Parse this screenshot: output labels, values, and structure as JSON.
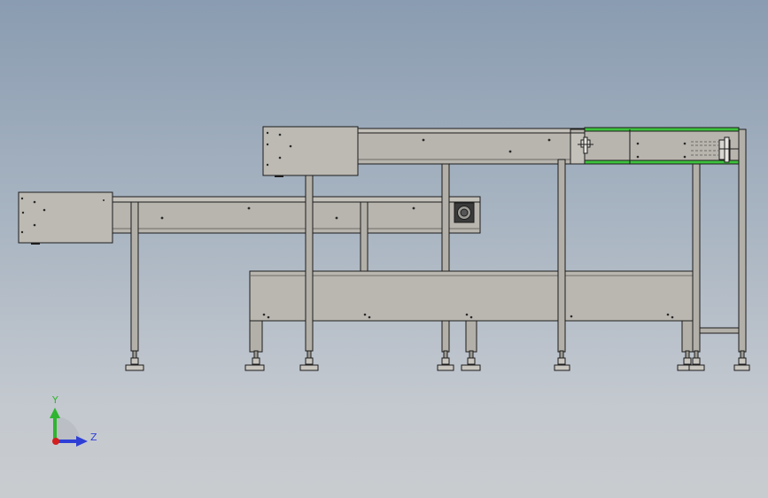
{
  "colors": {
    "frame_fill": "#b8b5ae",
    "frame_fill_light": "#c4c1ba",
    "frame_dark": "#8c8a85",
    "outline": "#1c1c1c",
    "belt_green": "#3ec23e",
    "axis_y": "#2fb52f",
    "axis_z": "#2f3fd6",
    "axis_x": "#d41e1e"
  },
  "triad": {
    "y_label": "Y",
    "z_label": "Z"
  }
}
